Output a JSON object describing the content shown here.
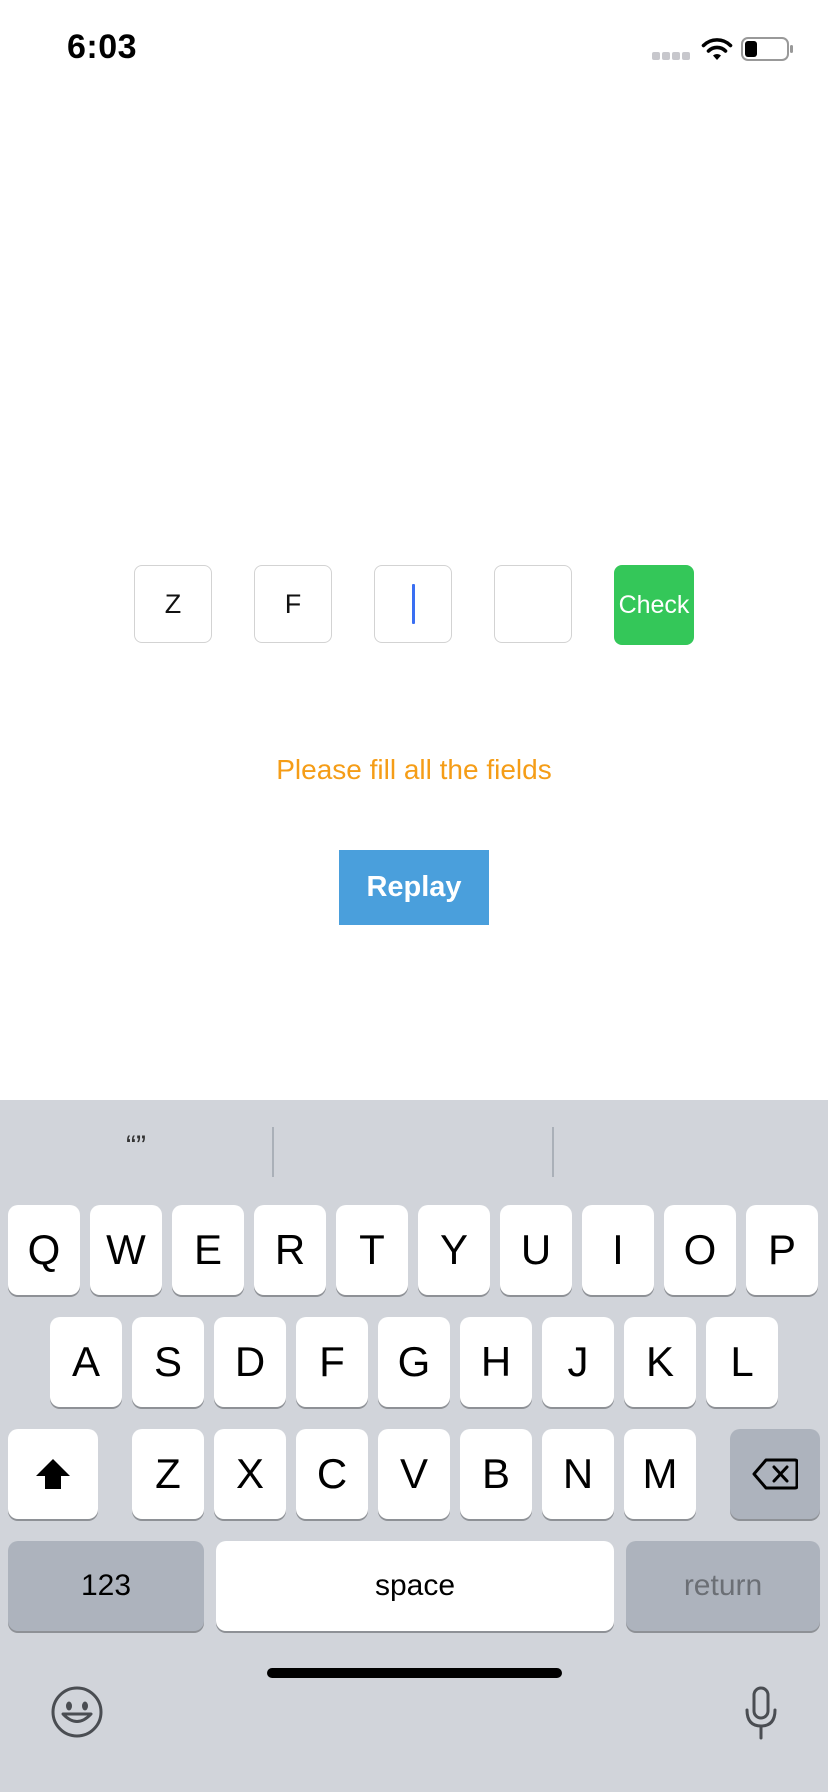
{
  "status_bar": {
    "time": "6:03"
  },
  "code_inputs": [
    {
      "value": "Z"
    },
    {
      "value": "F"
    },
    {
      "value": ""
    },
    {
      "value": ""
    }
  ],
  "check_label": "Check",
  "message": "Please fill all the fields",
  "replay_label": "Replay",
  "keyboard": {
    "suggestions": [
      "“”",
      "",
      ""
    ],
    "row1": [
      "Q",
      "W",
      "E",
      "R",
      "T",
      "Y",
      "U",
      "I",
      "O",
      "P"
    ],
    "row2": [
      "A",
      "S",
      "D",
      "F",
      "G",
      "H",
      "J",
      "K",
      "L"
    ],
    "row3": [
      "Z",
      "X",
      "C",
      "V",
      "B",
      "N",
      "M"
    ],
    "numbers_label": "123",
    "space_label": "space",
    "return_label": "return"
  },
  "colors": {
    "check": "#34c759",
    "replay": "#4a9fdc",
    "message": "#f59d17",
    "caret": "#3a6ff2"
  }
}
